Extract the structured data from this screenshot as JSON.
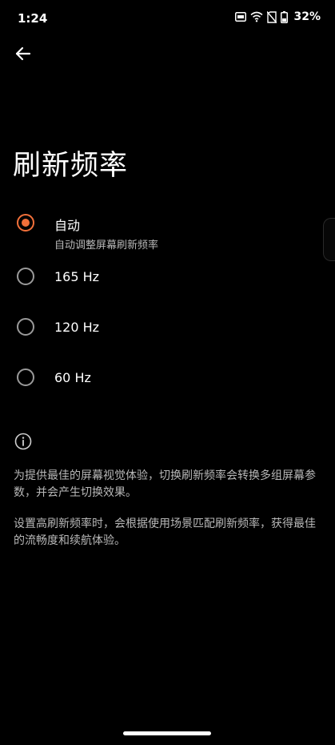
{
  "status_bar": {
    "time": "1:24",
    "icons": [
      "nfc-icon",
      "wifi-icon",
      "no-sim-icon",
      "battery-icon"
    ],
    "battery_percent": "32%"
  },
  "header": {
    "back_icon": "back-arrow-icon"
  },
  "title": "刷新频率",
  "options": [
    {
      "label": "自动",
      "sublabel": "自动调整屏幕刷新频率",
      "selected": true
    },
    {
      "label": "165 Hz",
      "selected": false
    },
    {
      "label": "120 Hz",
      "selected": false
    },
    {
      "label": "60 Hz",
      "selected": false
    }
  ],
  "info": {
    "icon": "info-icon",
    "paragraphs": [
      "为提供最佳的屏幕视觉体验，切换刷新频率会转换多组屏幕参数，并会产生切换效果。",
      "设置高刷新频率时，会根据使用场景匹配刷新频率，获得最佳的流畅度和续航体验。"
    ]
  },
  "colors": {
    "accent": "#f2703a",
    "background": "#000000",
    "secondary_text": "#b8b8b8"
  }
}
